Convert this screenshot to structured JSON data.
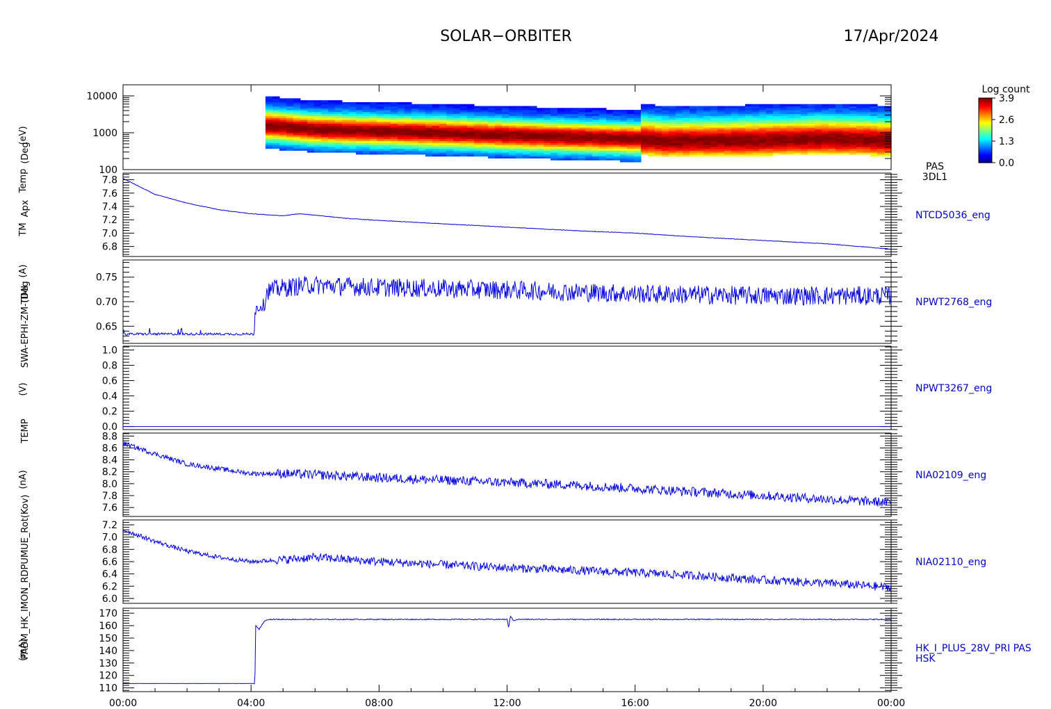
{
  "header": {
    "title": "SOLAR−ORBITER",
    "date": "17/Apr/2024"
  },
  "y_axis_overlay_labels": [
    "(eV)",
    "(Deg",
    "Temp",
    "Apx",
    "TM",
    "SWA-EPHI-ZM-TIMI",
    "(A)",
    "(Deg",
    "(V)",
    "TEMP",
    "(nA)",
    "PADM_HK_IMON_RDPUMUE_Rot(Kov)",
    "(mA)"
  ],
  "colors": {
    "trace": "#0000dd",
    "label": "#0000cc",
    "axes": "#000000"
  },
  "chart_data": [
    {
      "type": "heatmap",
      "panel_label": [
        "PAS",
        "3DL1"
      ],
      "ylabel": "(eV)",
      "yscale": "log",
      "ylim": [
        100,
        20000
      ],
      "y_ticks": [
        "10000",
        "1000",
        "100"
      ],
      "x_start_hours": 4.45,
      "colorbar": {
        "title": "Log count",
        "ticks": [
          "3.9",
          "2.6",
          "1.3",
          "0.0"
        ],
        "range": [
          0.0,
          3.9
        ]
      },
      "peak_energy_eV": [
        {
          "t": 4.5,
          "e": 1600
        },
        {
          "t": 6,
          "e": 1250
        },
        {
          "t": 8,
          "e": 1120
        },
        {
          "t": 10,
          "e": 1000
        },
        {
          "t": 12,
          "e": 870
        },
        {
          "t": 14,
          "e": 780
        },
        {
          "t": 16,
          "e": 700
        },
        {
          "t": 17,
          "e": 600
        },
        {
          "t": 20,
          "e": 640
        },
        {
          "t": 22,
          "e": 700
        },
        {
          "t": 24,
          "e": 620
        }
      ]
    },
    {
      "type": "line",
      "name": "NTCD5036_eng",
      "ylim": [
        6.65,
        7.9
      ],
      "y_ticks": [
        "7.8",
        "7.6",
        "7.4",
        "7.2",
        "7.0",
        "6.8"
      ],
      "x": [
        0,
        1,
        2,
        3,
        4,
        5,
        5.5,
        6,
        7,
        8,
        10,
        12,
        14,
        16,
        18,
        20,
        22,
        24
      ],
      "y": [
        7.82,
        7.58,
        7.45,
        7.35,
        7.29,
        7.26,
        7.29,
        7.27,
        7.22,
        7.19,
        7.14,
        7.09,
        7.04,
        7.0,
        6.94,
        6.89,
        6.84,
        6.76
      ]
    },
    {
      "type": "line",
      "name": "NPWT2768_eng",
      "ylim": [
        0.615,
        0.785
      ],
      "y_ticks": [
        "0.75",
        "0.70",
        "0.65"
      ],
      "x": [
        0,
        4.1,
        4.12,
        4.4,
        4.5,
        5,
        5.8,
        8,
        12,
        16,
        20,
        24
      ],
      "y": [
        0.634,
        0.634,
        0.684,
        0.695,
        0.722,
        0.728,
        0.734,
        0.729,
        0.724,
        0.716,
        0.712,
        0.712
      ]
    },
    {
      "type": "line",
      "name": "NPWT3267_eng",
      "ylim": [
        -0.04,
        1.05
      ],
      "y_ticks": [
        "1.0",
        "0.8",
        "0.6",
        "0.4",
        "0.2",
        "0.0"
      ],
      "x": [
        0,
        24
      ],
      "y": [
        0.0,
        0.0
      ]
    },
    {
      "type": "line",
      "name": "NIA02109_eng",
      "ylim": [
        7.45,
        8.85
      ],
      "y_ticks": [
        "8.8",
        "8.6",
        "8.4",
        "8.2",
        "8.0",
        "7.8",
        "7.6"
      ],
      "x": [
        0,
        1,
        2,
        3,
        4,
        5,
        6,
        8,
        10,
        12,
        14,
        16,
        18,
        20,
        22,
        24
      ],
      "y": [
        8.68,
        8.5,
        8.33,
        8.25,
        8.17,
        8.17,
        8.15,
        8.1,
        8.06,
        8.02,
        7.98,
        7.92,
        7.86,
        7.8,
        7.74,
        7.68
      ]
    },
    {
      "type": "line",
      "name": "NIA02110_eng",
      "ylim": [
        5.92,
        7.28
      ],
      "y_ticks": [
        "7.2",
        "7.0",
        "6.8",
        "6.6",
        "6.4",
        "6.2",
        "6.0"
      ],
      "x": [
        0,
        1,
        2,
        3,
        4,
        5,
        6,
        8,
        10,
        12,
        14,
        16,
        18,
        20,
        22,
        24
      ],
      "y": [
        7.12,
        6.93,
        6.77,
        6.67,
        6.6,
        6.63,
        6.67,
        6.6,
        6.55,
        6.5,
        6.46,
        6.42,
        6.37,
        6.3,
        6.25,
        6.18
      ]
    },
    {
      "type": "line",
      "name": "HK_I_PLUS_28V_PRI PAS",
      "name_line2": "HSK",
      "ylim": [
        107,
        174
      ],
      "y_ticks": [
        "170",
        "160",
        "150",
        "140",
        "130",
        "120",
        "110"
      ],
      "x": [
        0,
        4.12,
        4.14,
        4.25,
        4.4,
        4.5,
        12.0,
        12.05,
        12.1,
        12.2,
        12.3,
        24
      ],
      "y": [
        113.5,
        113.5,
        160,
        157,
        163,
        165,
        165,
        158,
        168,
        164,
        165,
        165
      ]
    }
  ],
  "x_axis": {
    "ticks": [
      "00:00",
      "04:00",
      "08:00",
      "12:00",
      "16:00",
      "20:00",
      "00:00"
    ],
    "range_hours": [
      0,
      24
    ]
  }
}
